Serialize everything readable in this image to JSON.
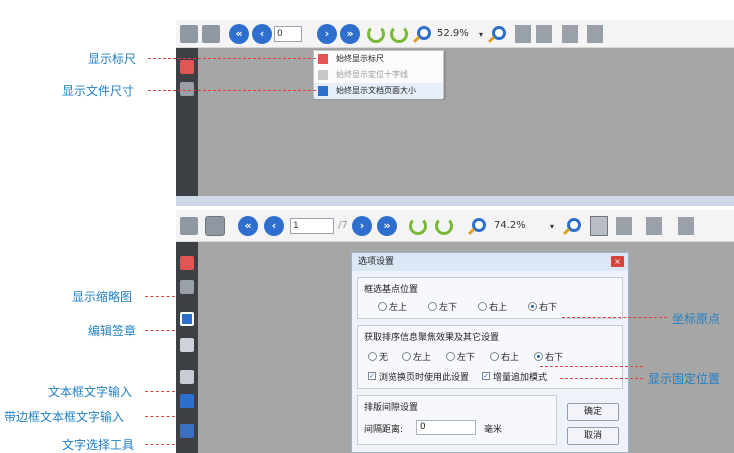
{
  "annotations": {
    "show_ruler": "显示标尺",
    "show_file_size": "显示文件尺寸",
    "show_thumbnail": "显示缩略图",
    "edit_signature": "编辑签章",
    "text_box_input": "文本框文字输入",
    "bordered_text_box_input": "带边框文本框文字输入",
    "text_select_tool": "文字选择工具",
    "coordinate_origin": "坐标原点",
    "show_fixed_position": "显示固定位置"
  },
  "top_panel": {
    "page_input": "0",
    "zoom": "52.9%",
    "menu": {
      "item1": "始终显示标尺",
      "item2": "始终显示定位十字线",
      "item3": "始终显示文档页面大小"
    }
  },
  "bottom_panel": {
    "page_input": "1",
    "page_sep": "/7",
    "zoom": "74.2%"
  },
  "dialog": {
    "title": "选项设置",
    "close": "×",
    "group1": {
      "title": "框选基点位置",
      "options": [
        "左上",
        "左下",
        "右上",
        "右下"
      ],
      "selected": "右下"
    },
    "group2": {
      "title": "获取排序信息聚焦效果及其它设置",
      "options": [
        "无",
        "左上",
        "左下",
        "右上",
        "右下"
      ],
      "selected": "右下",
      "check1": "浏览换页时使用此设置",
      "check2": "增量追加模式"
    },
    "group3": {
      "title": "排版间隙设置",
      "label": "间隔距离:",
      "value": "0",
      "unit": "毫米"
    },
    "ok": "确定",
    "cancel": "取消"
  },
  "colors": {
    "annotation_text": "#1f7fc4",
    "leader": "#e04040",
    "sidebar": "#3c3f44",
    "canvas": "#a6a6a6",
    "nav_blue": "#2e6fce",
    "rotate_green": "#7ab83a"
  }
}
